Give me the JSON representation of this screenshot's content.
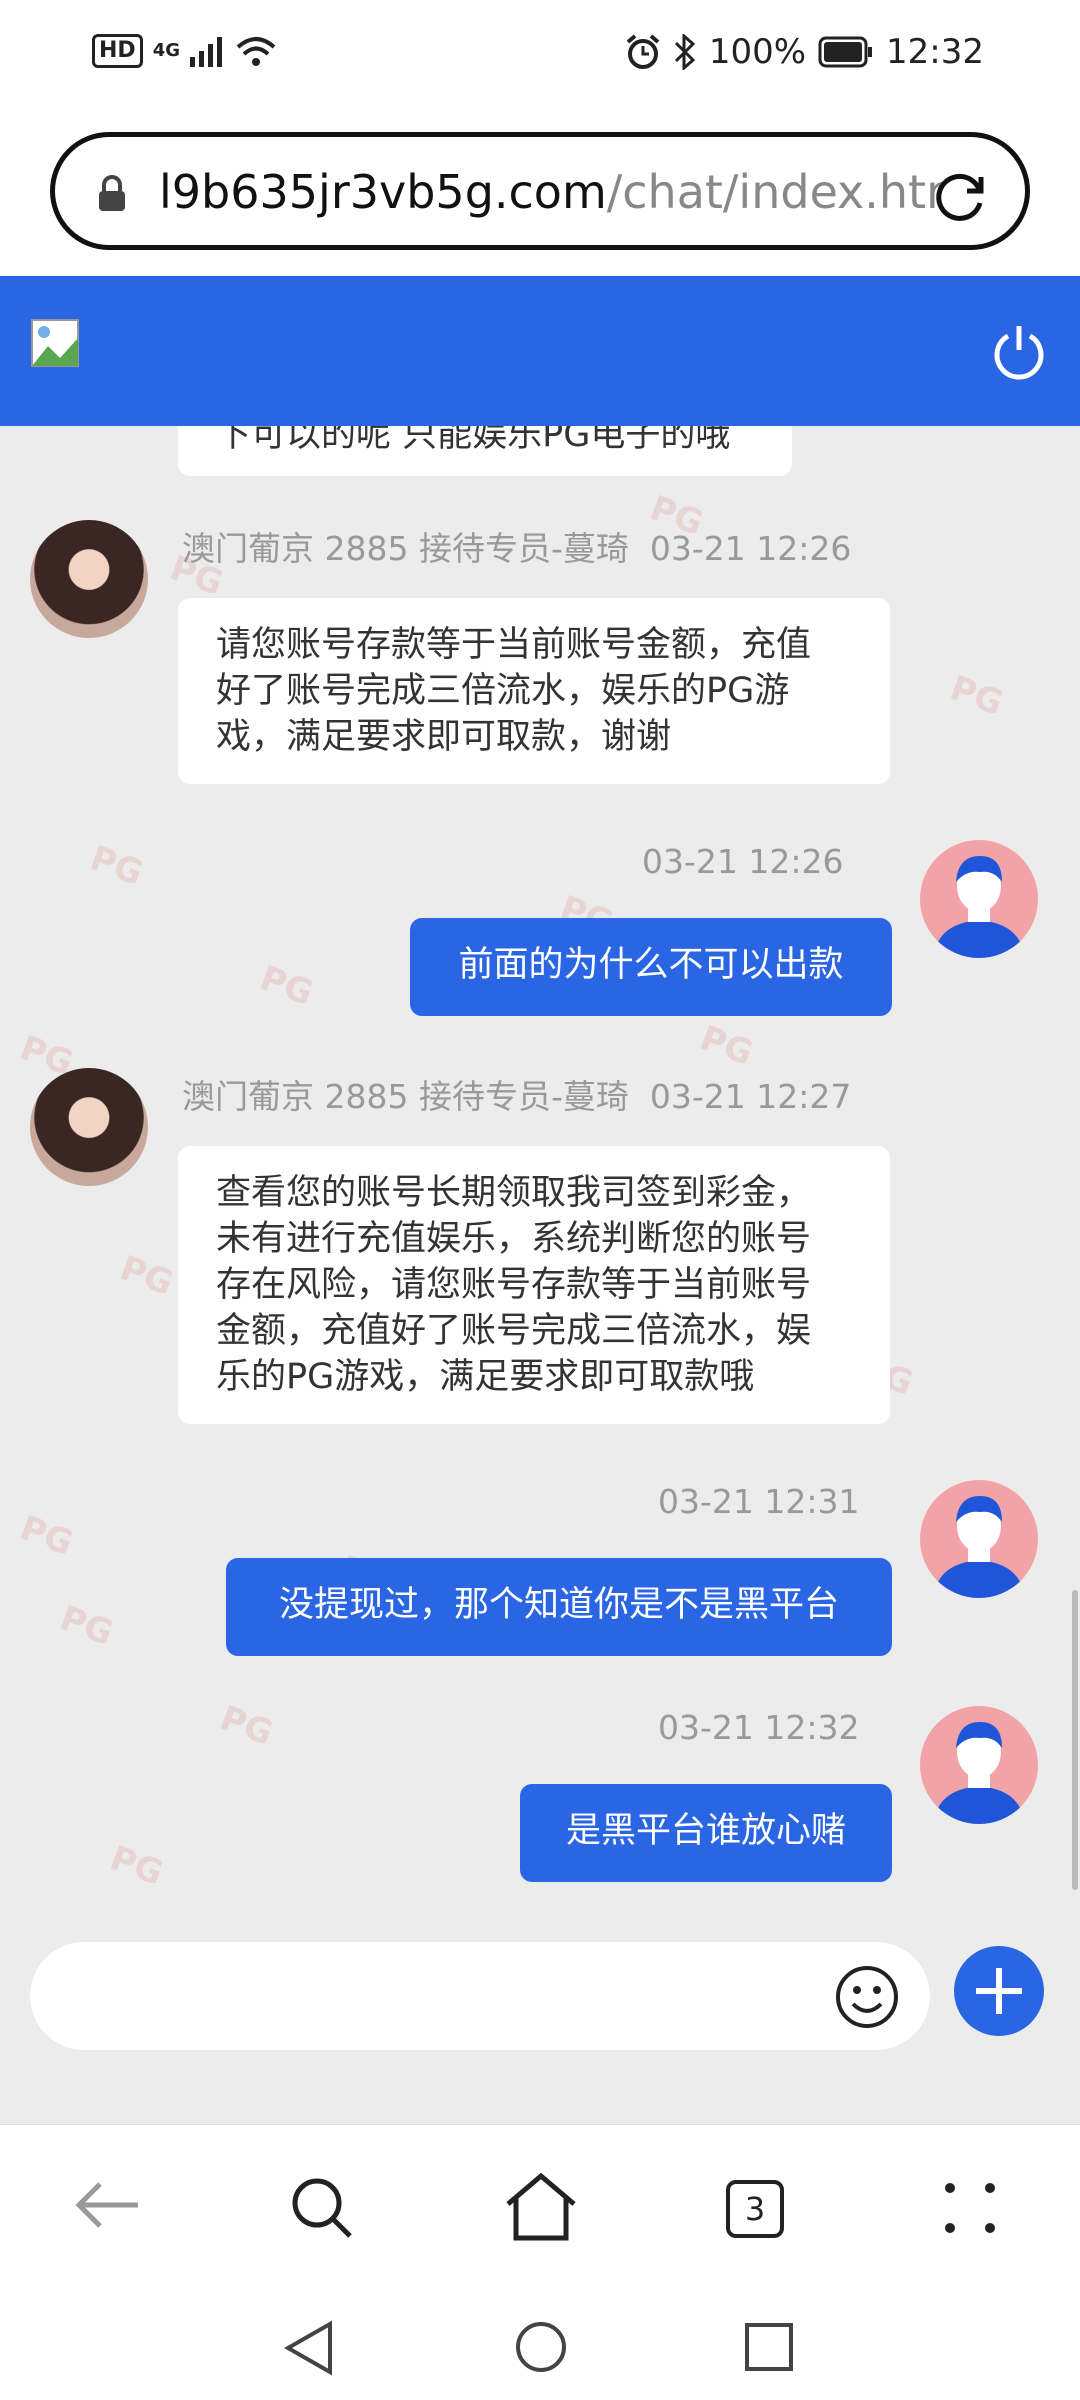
{
  "status_bar": {
    "left_badge": "HD",
    "network": "4G",
    "battery": "100%",
    "time": "12:32"
  },
  "url_bar": {
    "domain": "l9b635jr3vb5g.com",
    "path": "/chat/index.htr"
  },
  "watermark_text": "PG",
  "messages": [
    {
      "id": "partial",
      "text": "下可以的呢 只能娱乐PG电子的哦"
    },
    {
      "id": "m1",
      "sender": "澳门葡京 2885 接待专员-蔓琦",
      "time": "03-21 12:26",
      "lines": [
        "请您账号存款等于当前账号金额，充值",
        "好了账号完成三倍流水，娱乐的PG游",
        "戏，满足要求即可取款，谢谢"
      ]
    },
    {
      "id": "m2",
      "time": "03-21 12:26",
      "text": "前面的为什么不可以出款"
    },
    {
      "id": "m3",
      "sender": "澳门葡京 2885 接待专员-蔓琦",
      "time": "03-21 12:27",
      "lines": [
        "查看您的账号长期领取我司签到彩金，",
        "未有进行充值娱乐，系统判断您的账号",
        "存在风险，请您账号存款等于当前账号",
        "金额，充值好了账号完成三倍流水，娱",
        "乐的PG游戏，满足要求即可取款哦"
      ]
    },
    {
      "id": "m4",
      "time": "03-21 12:31",
      "text": "没提现过，那个知道你是不是黑平台"
    },
    {
      "id": "m5",
      "time": "03-21 12:32",
      "text": "是黑平台谁放心赌"
    }
  ],
  "input": {
    "placeholder": ""
  },
  "browser_nav": {
    "tab_count": "3"
  },
  "colors": {
    "brand_blue": "#2a66e3",
    "chat_bg": "#ececec"
  },
  "icons": [
    "lock-icon",
    "refresh-icon",
    "broken-image-icon",
    "power-icon",
    "emoji-icon",
    "add-icon",
    "back-icon",
    "search-icon",
    "home-icon",
    "tabs-icon",
    "menu-icon",
    "nav-back-icon",
    "nav-home-icon",
    "nav-recents-icon"
  ]
}
